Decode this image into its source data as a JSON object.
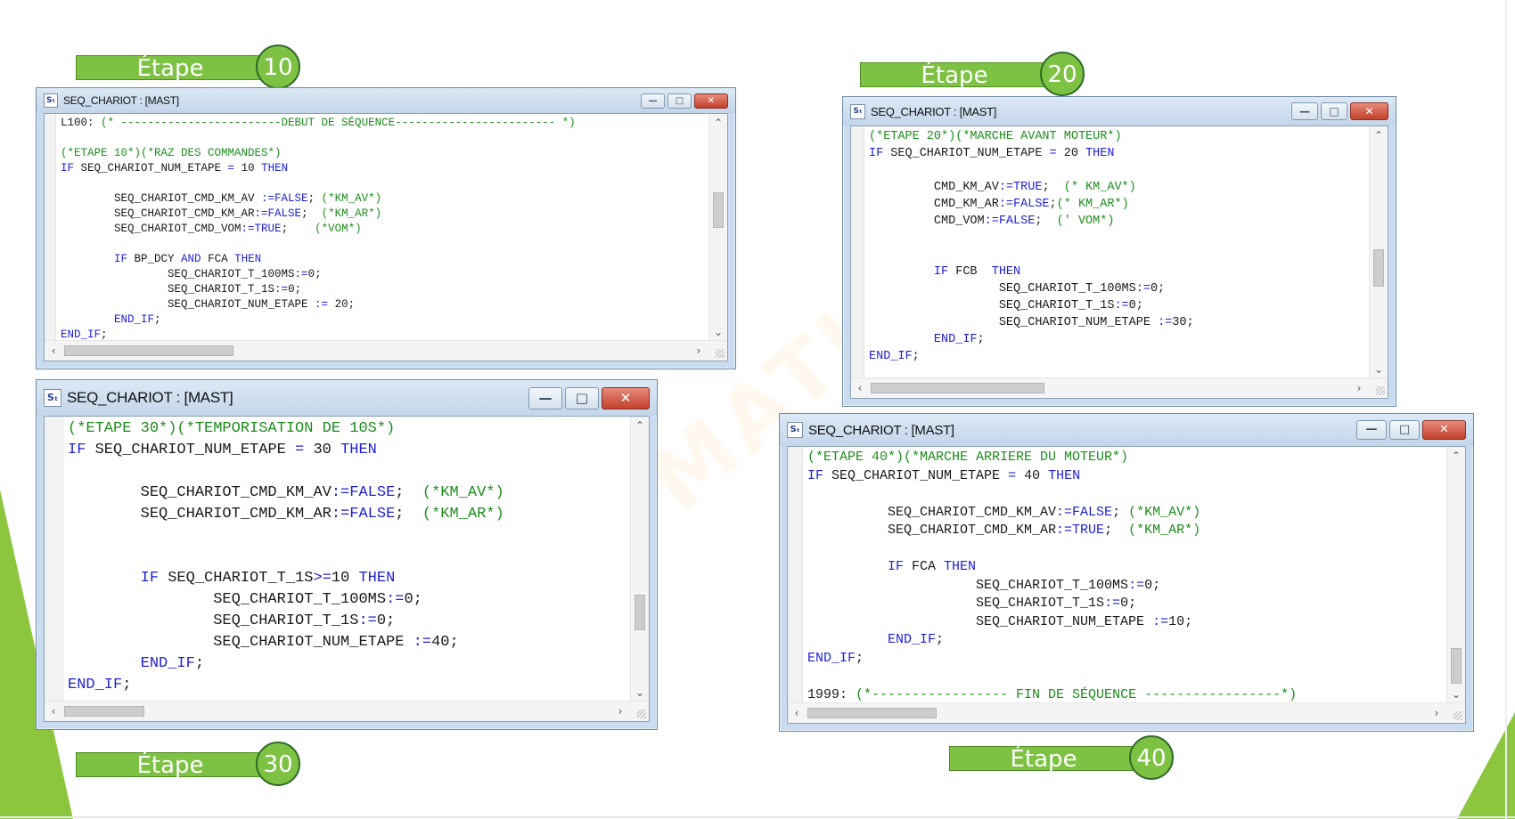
{
  "colors": {
    "accent_green": "#7dc242",
    "keyword_blue": "#1f1fd2",
    "comment_green": "#1e8c1e",
    "window_frame": "#c9dcef"
  },
  "badges": [
    {
      "label": "Étape",
      "number": "10"
    },
    {
      "label": "Étape",
      "number": "20"
    },
    {
      "label": "Étape",
      "number": "30"
    },
    {
      "label": "Étape",
      "number": "40"
    }
  ],
  "windows": [
    {
      "title": "SEQ_CHARIOT : [MAST]",
      "icon": "st-program-icon",
      "lines": [
        [
          [
            "t",
            "L100: "
          ],
          [
            "c",
            "(* ------------------------DEBUT DE SÉQUENCE------------------------ *)"
          ]
        ],
        [],
        [
          [
            "c",
            "(*ETAPE 10*)(*RAZ DES COMMANDES*)"
          ]
        ],
        [
          [
            "k",
            "IF"
          ],
          [
            "t",
            " SEQ_CHARIOT_NUM_ETAPE "
          ],
          [
            "k",
            "="
          ],
          [
            "t",
            " 10 "
          ],
          [
            "k",
            "THEN"
          ]
        ],
        [],
        [
          [
            "t",
            "        SEQ_CHARIOT_CMD_KM_AV "
          ],
          [
            "k",
            ":=FALSE"
          ],
          [
            "t",
            "; "
          ],
          [
            "c",
            "(*KM_AV*)"
          ]
        ],
        [
          [
            "t",
            "        SEQ_CHARIOT_CMD_KM_AR"
          ],
          [
            "k",
            ":=FALSE"
          ],
          [
            "t",
            ";  "
          ],
          [
            "c",
            "(*KM_AR*)"
          ]
        ],
        [
          [
            "t",
            "        SEQ_CHARIOT_CMD_VOM"
          ],
          [
            "k",
            ":=TRUE"
          ],
          [
            "t",
            ";    "
          ],
          [
            "c",
            "(*VOM*)"
          ]
        ],
        [],
        [
          [
            "t",
            "        "
          ],
          [
            "k",
            "IF"
          ],
          [
            "t",
            " BP_DCY "
          ],
          [
            "k",
            "AND"
          ],
          [
            "t",
            " FCA "
          ],
          [
            "k",
            "THEN"
          ]
        ],
        [
          [
            "t",
            "                SEQ_CHARIOT_T_100MS"
          ],
          [
            "k",
            ":="
          ],
          [
            "t",
            "0;"
          ]
        ],
        [
          [
            "t",
            "                SEQ_CHARIOT_T_1S"
          ],
          [
            "k",
            ":="
          ],
          [
            "t",
            "0;"
          ]
        ],
        [
          [
            "t",
            "                SEQ_CHARIOT_NUM_ETAPE "
          ],
          [
            "k",
            ":="
          ],
          [
            "t",
            " 20;"
          ]
        ],
        [
          [
            "t",
            "        "
          ],
          [
            "k",
            "END_IF"
          ],
          [
            "t",
            ";"
          ]
        ],
        [
          [
            "k",
            "END_IF"
          ],
          [
            "t",
            ";"
          ]
        ]
      ]
    },
    {
      "title": "SEQ_CHARIOT : [MAST]",
      "icon": "st-program-icon",
      "lines": [
        [
          [
            "c",
            "(*ETAPE 20*)(*MARCHE AVANT MOTEUR*)"
          ]
        ],
        [
          [
            "k",
            "IF"
          ],
          [
            "t",
            " SEQ_CHARIOT_NUM_ETAPE "
          ],
          [
            "k",
            "="
          ],
          [
            "t",
            " 20 "
          ],
          [
            "k",
            "THEN"
          ]
        ],
        [],
        [
          [
            "t",
            "         CMD_KM_AV"
          ],
          [
            "k",
            ":=TRUE"
          ],
          [
            "t",
            ";  "
          ],
          [
            "c",
            "(* KM_AV*)"
          ]
        ],
        [
          [
            "t",
            "         CMD_KM_AR"
          ],
          [
            "k",
            ":=FALSE"
          ],
          [
            "t",
            ";"
          ],
          [
            "c",
            "(* KM_AR*)"
          ]
        ],
        [
          [
            "t",
            "         CMD_VOM"
          ],
          [
            "k",
            ":=FALSE"
          ],
          [
            "t",
            ";  "
          ],
          [
            "c",
            "(' VOM*)"
          ]
        ],
        [],
        [],
        [
          [
            "t",
            "         "
          ],
          [
            "k",
            "IF"
          ],
          [
            "t",
            " FCB  "
          ],
          [
            "k",
            "THEN"
          ]
        ],
        [
          [
            "t",
            "                  SEQ_CHARIOT_T_100MS"
          ],
          [
            "k",
            ":="
          ],
          [
            "t",
            "0;"
          ]
        ],
        [
          [
            "t",
            "                  SEQ_CHARIOT_T_1S"
          ],
          [
            "k",
            ":="
          ],
          [
            "t",
            "0;"
          ]
        ],
        [
          [
            "t",
            "                  SEQ_CHARIOT_NUM_ETAPE "
          ],
          [
            "k",
            ":="
          ],
          [
            "t",
            "30;"
          ]
        ],
        [
          [
            "t",
            "         "
          ],
          [
            "k",
            "END_IF"
          ],
          [
            "t",
            ";"
          ]
        ],
        [
          [
            "k",
            "END_IF"
          ],
          [
            "t",
            ";"
          ]
        ]
      ]
    },
    {
      "title": "SEQ_CHARIOT : [MAST]",
      "icon": "st-program-icon",
      "lines": [
        [
          [
            "c",
            "(*ETAPE 30*)(*TEMPORISATION DE 10S*)"
          ]
        ],
        [
          [
            "k",
            "IF"
          ],
          [
            "t",
            " SEQ_CHARIOT_NUM_ETAPE "
          ],
          [
            "k",
            "="
          ],
          [
            "t",
            " 30 "
          ],
          [
            "k",
            "THEN"
          ]
        ],
        [],
        [
          [
            "t",
            "        SEQ_CHARIOT_CMD_KM_AV"
          ],
          [
            "k",
            ":=FALSE"
          ],
          [
            "t",
            ";  "
          ],
          [
            "c",
            "(*KM_AV*)"
          ]
        ],
        [
          [
            "t",
            "        SEQ_CHARIOT_CMD_KM_AR"
          ],
          [
            "k",
            ":=FALSE"
          ],
          [
            "t",
            ";  "
          ],
          [
            "c",
            "(*KM_AR*)"
          ]
        ],
        [],
        [],
        [
          [
            "t",
            "        "
          ],
          [
            "k",
            "IF"
          ],
          [
            "t",
            " SEQ_CHARIOT_T_1S"
          ],
          [
            "k",
            ">="
          ],
          [
            "t",
            "10 "
          ],
          [
            "k",
            "THEN"
          ]
        ],
        [
          [
            "t",
            "                SEQ_CHARIOT_T_100MS"
          ],
          [
            "k",
            ":="
          ],
          [
            "t",
            "0;"
          ]
        ],
        [
          [
            "t",
            "                SEQ_CHARIOT_T_1S"
          ],
          [
            "k",
            ":="
          ],
          [
            "t",
            "0;"
          ]
        ],
        [
          [
            "t",
            "                SEQ_CHARIOT_NUM_ETAPE "
          ],
          [
            "k",
            ":="
          ],
          [
            "t",
            "40;"
          ]
        ],
        [
          [
            "t",
            "        "
          ],
          [
            "k",
            "END_IF"
          ],
          [
            "t",
            ";"
          ]
        ],
        [
          [
            "k",
            "END_IF"
          ],
          [
            "t",
            ";"
          ]
        ]
      ]
    },
    {
      "title": "SEQ_CHARIOT : [MAST]",
      "icon": "st-program-icon",
      "lines": [
        [
          [
            "c",
            "(*ETAPE 40*)(*MARCHE ARRIERE DU MOTEUR*)"
          ]
        ],
        [
          [
            "k",
            "IF"
          ],
          [
            "t",
            " SEQ_CHARIOT_NUM_ETAPE "
          ],
          [
            "k",
            "="
          ],
          [
            "t",
            " 40 "
          ],
          [
            "k",
            "THEN"
          ]
        ],
        [],
        [
          [
            "t",
            "          SEQ_CHARIOT_CMD_KM_AV"
          ],
          [
            "k",
            ":=FALSE"
          ],
          [
            "t",
            "; "
          ],
          [
            "c",
            "(*KM_AV*)"
          ]
        ],
        [
          [
            "t",
            "          SEQ_CHARIOT_CMD_KM_AR"
          ],
          [
            "k",
            ":=TRUE"
          ],
          [
            "t",
            ";  "
          ],
          [
            "c",
            "(*KM_AR*)"
          ]
        ],
        [],
        [
          [
            "t",
            "          "
          ],
          [
            "k",
            "IF"
          ],
          [
            "t",
            " FCA "
          ],
          [
            "k",
            "THEN"
          ]
        ],
        [
          [
            "t",
            "                     SEQ_CHARIOT_T_100MS"
          ],
          [
            "k",
            ":="
          ],
          [
            "t",
            "0;"
          ]
        ],
        [
          [
            "t",
            "                     SEQ_CHARIOT_T_1S"
          ],
          [
            "k",
            ":="
          ],
          [
            "t",
            "0;"
          ]
        ],
        [
          [
            "t",
            "                     SEQ_CHARIOT_NUM_ETAPE "
          ],
          [
            "k",
            ":="
          ],
          [
            "t",
            "10;"
          ]
        ],
        [
          [
            "t",
            "          "
          ],
          [
            "k",
            "END_IF"
          ],
          [
            "t",
            ";"
          ]
        ],
        [
          [
            "k",
            "END_IF"
          ],
          [
            "t",
            ";"
          ]
        ],
        [],
        [
          [
            "t",
            "1999: "
          ],
          [
            "c",
            "(*----------------- FIN DE SÉQUENCE -----------------*)"
          ]
        ]
      ]
    }
  ]
}
